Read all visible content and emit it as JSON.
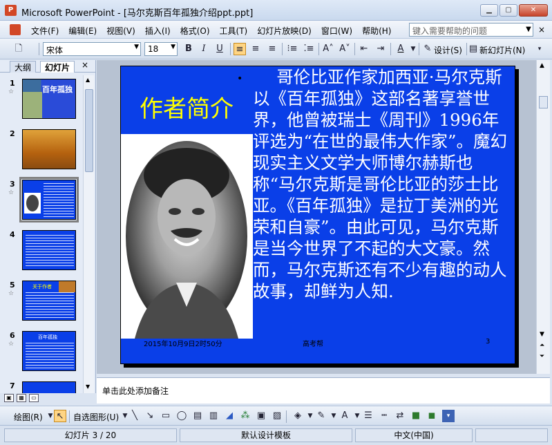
{
  "window": {
    "title": "Microsoft PowerPoint - [马尔克斯百年孤独介绍ppt.ppt]",
    "app_icon_label": "P"
  },
  "menu": {
    "items": [
      "文件(F)",
      "编辑(E)",
      "视图(V)",
      "插入(I)",
      "格式(O)",
      "工具(T)",
      "幻灯片放映(D)",
      "窗口(W)",
      "帮助(H)"
    ],
    "help_placeholder": "键入需要帮助的问题",
    "close": "×"
  },
  "toolbar": {
    "font_name": "宋体",
    "font_size": "18",
    "bold": "B",
    "italic": "I",
    "underline": "U",
    "design_label": "设计(S)",
    "new_slide_label": "新幻灯片(N)"
  },
  "left_panel": {
    "tabs": [
      "大纲",
      "幻灯片"
    ],
    "active_tab": "幻灯片",
    "close": "×",
    "thumbnails": [
      {
        "number": "1",
        "title": "百年孤独"
      },
      {
        "number": "2",
        "title": ""
      },
      {
        "number": "3",
        "title": ""
      },
      {
        "number": "4",
        "title": ""
      },
      {
        "number": "5",
        "title": "关于作者"
      },
      {
        "number": "6",
        "title": "百年孤独"
      },
      {
        "number": "7",
        "title": ""
      }
    ],
    "selected_index": 2
  },
  "slide": {
    "heading": "作者简介",
    "bullet": "•",
    "body": "哥伦比亚作家加西亚·马尔克斯以《百年孤独》这部名著享誉世界，他曾被瑞士《周刊》1996年评选为“在世的最伟大作家”。魔幻现实主义文学大师博尔赫斯也称“马尔克斯是哥伦比亚的莎士比亚。《百年孤独》是拉丁美洲的光荣和自豪”。由此可见，马尔克斯是当今世界了不起的大文豪。然而，马尔克斯还有不少有趣的动人故事，却鲜为人知.",
    "footer_date": "2015年10月9日2时50分",
    "footer_mid": "高考帮",
    "footer_page": "3"
  },
  "notes": {
    "placeholder": "单击此处添加备注"
  },
  "draw_toolbar": {
    "draw_label": "绘图(R)",
    "autoshape_label": "自选图形(U)"
  },
  "status": {
    "slide_position": "幻灯片 3 / 20",
    "template": "默认设计模板",
    "language": "中文(中国)"
  },
  "colors": {
    "slide_background": "#0a3fe8",
    "heading": "#ffff00",
    "body_text": "#ffffff"
  }
}
